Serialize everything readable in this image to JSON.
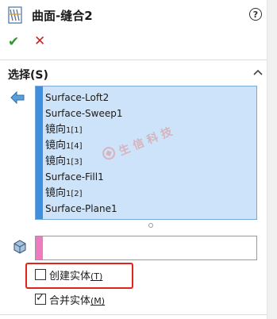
{
  "header": {
    "title": "曲面-缝合2",
    "help_label": "?",
    "ok_symbol": "✔",
    "cancel_symbol": "✕"
  },
  "selection": {
    "section_title": "选择(S)",
    "items": [
      {
        "main": "Surface-Loft2",
        "sub": ""
      },
      {
        "main": "Surface-Sweep1",
        "sub": ""
      },
      {
        "main": "镜向",
        "sub": "1[1]"
      },
      {
        "main": "镜向",
        "sub": "1[4]"
      },
      {
        "main": "镜向",
        "sub": "1[3]"
      },
      {
        "main": "Surface-Fill1",
        "sub": ""
      },
      {
        "main": "镜向",
        "sub": "1[2]"
      },
      {
        "main": "Surface-Plane1",
        "sub": ""
      }
    ],
    "body_field_value": ""
  },
  "options": {
    "create_solid": {
      "label": "创建实体",
      "accel": "(T)",
      "checked": false
    },
    "merge_solids": {
      "label": "合并实体",
      "accel": "(M)",
      "checked": true
    }
  },
  "watermark": {
    "text": "生信科技"
  },
  "colors": {
    "list_bg": "#cde3f9",
    "list_strip": "#3f8fdf",
    "body_strip": "#f07ac0",
    "highlight": "#e2231a",
    "ok": "#2e9b2e",
    "cancel": "#cc2222"
  }
}
